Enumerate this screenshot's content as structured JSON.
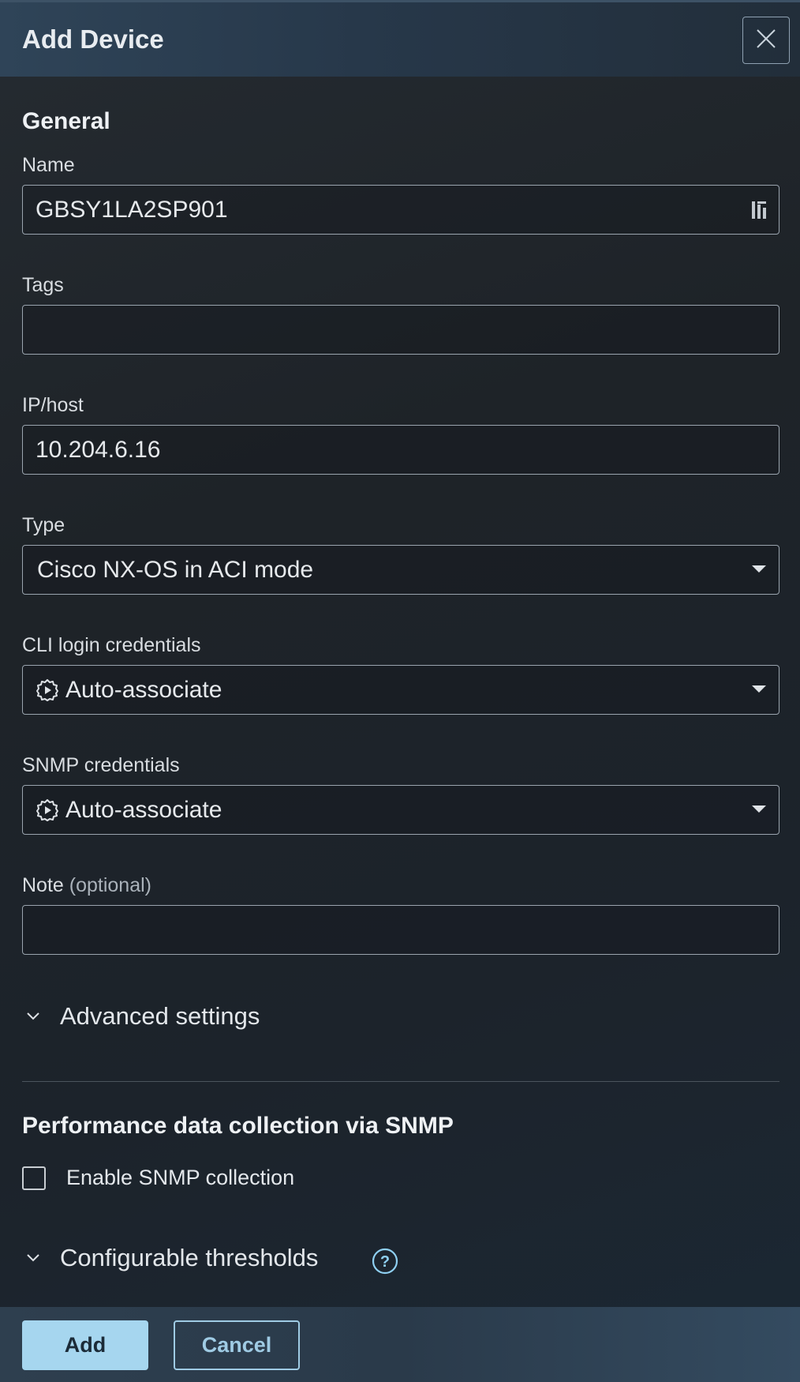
{
  "dialog": {
    "title": "Add Device",
    "close_icon": "close-icon"
  },
  "general": {
    "section_title": "General",
    "name": {
      "label": "Name",
      "value": "GBSY1LA2SP901",
      "icon": "password-manager-icon"
    },
    "tags": {
      "label": "Tags",
      "value": ""
    },
    "ip_host": {
      "label": "IP/host",
      "value": "10.204.6.16"
    },
    "type": {
      "label": "Type",
      "selected": "Cisco NX-OS in ACI mode"
    },
    "cli_credentials": {
      "label": "CLI login credentials",
      "selected": "Auto-associate",
      "icon": "auto-gear-icon"
    },
    "snmp_credentials": {
      "label": "SNMP credentials",
      "selected": "Auto-associate",
      "icon": "auto-gear-icon"
    },
    "note": {
      "label": "Note",
      "label_suffix": "(optional)",
      "value": ""
    },
    "advanced_settings": "Advanced settings"
  },
  "performance": {
    "section_title": "Performance data collection via SNMP",
    "enable_snmp_label": "Enable SNMP collection",
    "enable_snmp_checked": false,
    "thresholds_label": "Configurable thresholds",
    "help_icon": "help-icon"
  },
  "footer": {
    "add_label": "Add",
    "cancel_label": "Cancel"
  },
  "colors": {
    "primary_button": "#a6d6ef",
    "secondary_button_border": "#9fcbe4",
    "help_icon": "#8fd0f2"
  }
}
